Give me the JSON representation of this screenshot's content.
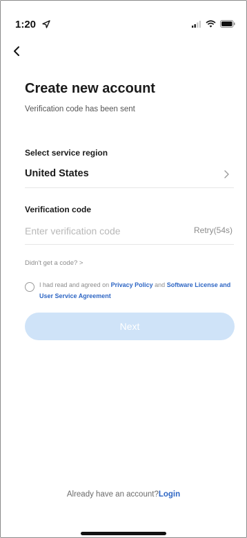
{
  "status_bar": {
    "time": "1:20"
  },
  "icons": {
    "location": "location-arrow-icon",
    "signal": "cellular-signal-icon",
    "wifi": "wifi-icon",
    "battery": "battery-icon",
    "back": "chevron-left-icon",
    "region_arrow": "chevron-right-icon"
  },
  "page": {
    "title": "Create new account",
    "subtitle": "Verification code has been sent"
  },
  "region": {
    "label": "Select service region",
    "value": "United States"
  },
  "verification": {
    "label": "Verification code",
    "placeholder": "Enter verification code",
    "value": "",
    "retry": "Retry(54s)",
    "no_code_link": "Didn't get a code? >"
  },
  "agreement": {
    "prefix": "I had read and agreed on",
    "privacy_link": "Privacy Policy",
    "connector": "and",
    "license_link": "Software License and User Service Agreement",
    "checked": false
  },
  "actions": {
    "next_label": "Next"
  },
  "footer": {
    "prompt": "Already have an account?",
    "login_link": "Login"
  },
  "colors": {
    "accent": "#2e66c4",
    "button_disabled": "#cfe3f8",
    "text_muted": "#8c8c8c"
  }
}
